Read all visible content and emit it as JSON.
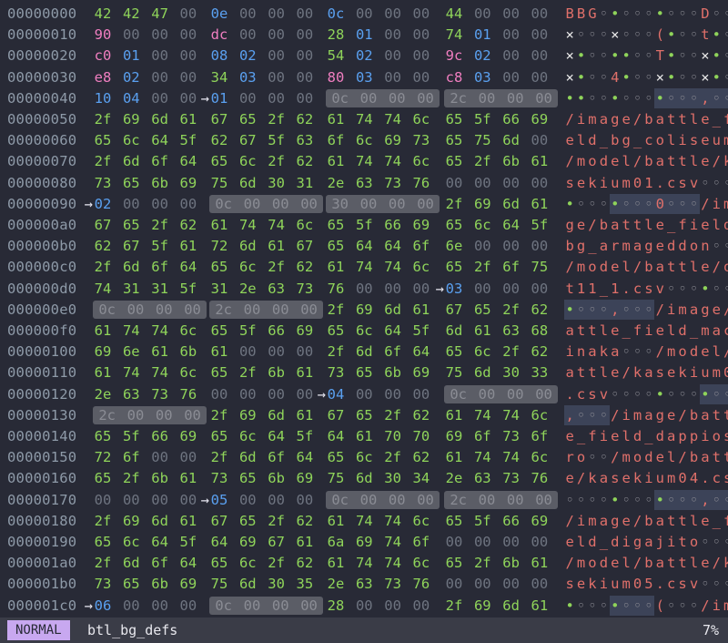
{
  "colors": {
    "zero": "#6e7480",
    "printable": "#8fd45a",
    "ascii_text": "#e0706a",
    "pink": "#f07ec0",
    "orange": "#f0a040",
    "teal": "#40c8a8",
    "blue": "#5aa0f0",
    "hl": "#5b5d66",
    "dot": "#8e8e96",
    "greendot": "#8fd45a"
  },
  "hex_view": {
    "rows": [
      {
        "offset": "00000000",
        "bytes": [
          "42",
          "42",
          "47",
          "00",
          "0e",
          "00",
          "00",
          "00",
          "0c",
          "00",
          "00",
          "00",
          "44",
          "00",
          "00",
          "00"
        ],
        "ascii": "BBG\u0000\u000e\u0000\u0000\u0000\f\u0000\u0000\u0000D\u0000\u0000\u0000"
      },
      {
        "offset": "00000010",
        "bytes": [
          "90",
          "00",
          "00",
          "00",
          "dc",
          "00",
          "00",
          "00",
          "28",
          "01",
          "00",
          "00",
          "74",
          "01",
          "00",
          "00"
        ]
      },
      {
        "offset": "00000020",
        "bytes": [
          "c0",
          "01",
          "00",
          "00",
          "08",
          "02",
          "00",
          "00",
          "54",
          "02",
          "00",
          "00",
          "9c",
          "02",
          "00",
          "00"
        ]
      },
      {
        "offset": "00000030",
        "bytes": [
          "e8",
          "02",
          "00",
          "00",
          "34",
          "03",
          "00",
          "00",
          "80",
          "03",
          "00",
          "00",
          "c8",
          "03",
          "00",
          "00"
        ]
      },
      {
        "offset": "00000040",
        "bytes": [
          "10",
          "04",
          "00",
          "00",
          "01",
          "00",
          "00",
          "00",
          "0c",
          "00",
          "00",
          "00",
          "2c",
          "00",
          "00",
          "00"
        ],
        "arrow": 4,
        "hl": [
          8,
          9,
          10,
          11,
          12,
          13,
          14,
          15
        ]
      },
      {
        "offset": "00000050",
        "bytes": [
          "2f",
          "69",
          "6d",
          "61",
          "67",
          "65",
          "2f",
          "62",
          "61",
          "74",
          "74",
          "6c",
          "65",
          "5f",
          "66",
          "69"
        ]
      },
      {
        "offset": "00000060",
        "bytes": [
          "65",
          "6c",
          "64",
          "5f",
          "62",
          "67",
          "5f",
          "63",
          "6f",
          "6c",
          "69",
          "73",
          "65",
          "75",
          "6d",
          "00"
        ]
      },
      {
        "offset": "00000070",
        "bytes": [
          "2f",
          "6d",
          "6f",
          "64",
          "65",
          "6c",
          "2f",
          "62",
          "61",
          "74",
          "74",
          "6c",
          "65",
          "2f",
          "6b",
          "61"
        ]
      },
      {
        "offset": "00000080",
        "bytes": [
          "73",
          "65",
          "6b",
          "69",
          "75",
          "6d",
          "30",
          "31",
          "2e",
          "63",
          "73",
          "76",
          "00",
          "00",
          "00",
          "00"
        ]
      },
      {
        "offset": "00000090",
        "bytes": [
          "02",
          "00",
          "00",
          "00",
          "0c",
          "00",
          "00",
          "00",
          "30",
          "00",
          "00",
          "00",
          "2f",
          "69",
          "6d",
          "61"
        ],
        "arrow": 0,
        "hl": [
          4,
          5,
          6,
          7,
          8,
          9,
          10,
          11
        ]
      },
      {
        "offset": "000000a0",
        "bytes": [
          "67",
          "65",
          "2f",
          "62",
          "61",
          "74",
          "74",
          "6c",
          "65",
          "5f",
          "66",
          "69",
          "65",
          "6c",
          "64",
          "5f"
        ]
      },
      {
        "offset": "000000b0",
        "bytes": [
          "62",
          "67",
          "5f",
          "61",
          "72",
          "6d",
          "61",
          "67",
          "65",
          "64",
          "64",
          "6f",
          "6e",
          "00",
          "00",
          "00"
        ]
      },
      {
        "offset": "000000c0",
        "bytes": [
          "2f",
          "6d",
          "6f",
          "64",
          "65",
          "6c",
          "2f",
          "62",
          "61",
          "74",
          "74",
          "6c",
          "65",
          "2f",
          "6f",
          "75"
        ]
      },
      {
        "offset": "000000d0",
        "bytes": [
          "74",
          "31",
          "31",
          "5f",
          "31",
          "2e",
          "63",
          "73",
          "76",
          "00",
          "00",
          "00",
          "03",
          "00",
          "00",
          "00"
        ],
        "arrow": 12
      },
      {
        "offset": "000000e0",
        "bytes": [
          "0c",
          "00",
          "00",
          "00",
          "2c",
          "00",
          "00",
          "00",
          "2f",
          "69",
          "6d",
          "61",
          "67",
          "65",
          "2f",
          "62"
        ],
        "hl": [
          0,
          1,
          2,
          3,
          4,
          5,
          6,
          7
        ]
      },
      {
        "offset": "000000f0",
        "bytes": [
          "61",
          "74",
          "74",
          "6c",
          "65",
          "5f",
          "66",
          "69",
          "65",
          "6c",
          "64",
          "5f",
          "6d",
          "61",
          "63",
          "68"
        ]
      },
      {
        "offset": "00000100",
        "bytes": [
          "69",
          "6e",
          "61",
          "6b",
          "61",
          "00",
          "00",
          "00",
          "2f",
          "6d",
          "6f",
          "64",
          "65",
          "6c",
          "2f",
          "62"
        ]
      },
      {
        "offset": "00000110",
        "bytes": [
          "61",
          "74",
          "74",
          "6c",
          "65",
          "2f",
          "6b",
          "61",
          "73",
          "65",
          "6b",
          "69",
          "75",
          "6d",
          "30",
          "33"
        ]
      },
      {
        "offset": "00000120",
        "bytes": [
          "2e",
          "63",
          "73",
          "76",
          "00",
          "00",
          "00",
          "00",
          "04",
          "00",
          "00",
          "00",
          "0c",
          "00",
          "00",
          "00"
        ],
        "arrow": 8,
        "hl": [
          12,
          13,
          14,
          15
        ]
      },
      {
        "offset": "00000130",
        "bytes": [
          "2c",
          "00",
          "00",
          "00",
          "2f",
          "69",
          "6d",
          "61",
          "67",
          "65",
          "2f",
          "62",
          "61",
          "74",
          "74",
          "6c"
        ],
        "hl": [
          0,
          1,
          2,
          3
        ]
      },
      {
        "offset": "00000140",
        "bytes": [
          "65",
          "5f",
          "66",
          "69",
          "65",
          "6c",
          "64",
          "5f",
          "64",
          "61",
          "70",
          "70",
          "69",
          "6f",
          "73",
          "6f"
        ]
      },
      {
        "offset": "00000150",
        "bytes": [
          "72",
          "6f",
          "00",
          "00",
          "2f",
          "6d",
          "6f",
          "64",
          "65",
          "6c",
          "2f",
          "62",
          "61",
          "74",
          "74",
          "6c"
        ]
      },
      {
        "offset": "00000160",
        "bytes": [
          "65",
          "2f",
          "6b",
          "61",
          "73",
          "65",
          "6b",
          "69",
          "75",
          "6d",
          "30",
          "34",
          "2e",
          "63",
          "73",
          "76"
        ]
      },
      {
        "offset": "00000170",
        "bytes": [
          "00",
          "00",
          "00",
          "00",
          "05",
          "00",
          "00",
          "00",
          "0c",
          "00",
          "00",
          "00",
          "2c",
          "00",
          "00",
          "00"
        ],
        "arrow": 4,
        "hl": [
          8,
          9,
          10,
          11,
          12,
          13,
          14,
          15
        ]
      },
      {
        "offset": "00000180",
        "bytes": [
          "2f",
          "69",
          "6d",
          "61",
          "67",
          "65",
          "2f",
          "62",
          "61",
          "74",
          "74",
          "6c",
          "65",
          "5f",
          "66",
          "69"
        ]
      },
      {
        "offset": "00000190",
        "bytes": [
          "65",
          "6c",
          "64",
          "5f",
          "64",
          "69",
          "67",
          "61",
          "6a",
          "69",
          "74",
          "6f",
          "00",
          "00",
          "00",
          "00"
        ]
      },
      {
        "offset": "000001a0",
        "bytes": [
          "2f",
          "6d",
          "6f",
          "64",
          "65",
          "6c",
          "2f",
          "62",
          "61",
          "74",
          "74",
          "6c",
          "65",
          "2f",
          "6b",
          "61"
        ]
      },
      {
        "offset": "000001b0",
        "bytes": [
          "73",
          "65",
          "6b",
          "69",
          "75",
          "6d",
          "30",
          "35",
          "2e",
          "63",
          "73",
          "76",
          "00",
          "00",
          "00",
          "00"
        ]
      },
      {
        "offset": "000001c0",
        "bytes": [
          "06",
          "00",
          "00",
          "00",
          "0c",
          "00",
          "00",
          "00",
          "28",
          "00",
          "00",
          "00",
          "2f",
          "69",
          "6d",
          "61"
        ],
        "arrow": 0,
        "hl": [
          4,
          5,
          6,
          7
        ]
      }
    ]
  },
  "status_bar": {
    "mode": "NORMAL",
    "filename": "btl_bg_defs",
    "position": "7%"
  }
}
